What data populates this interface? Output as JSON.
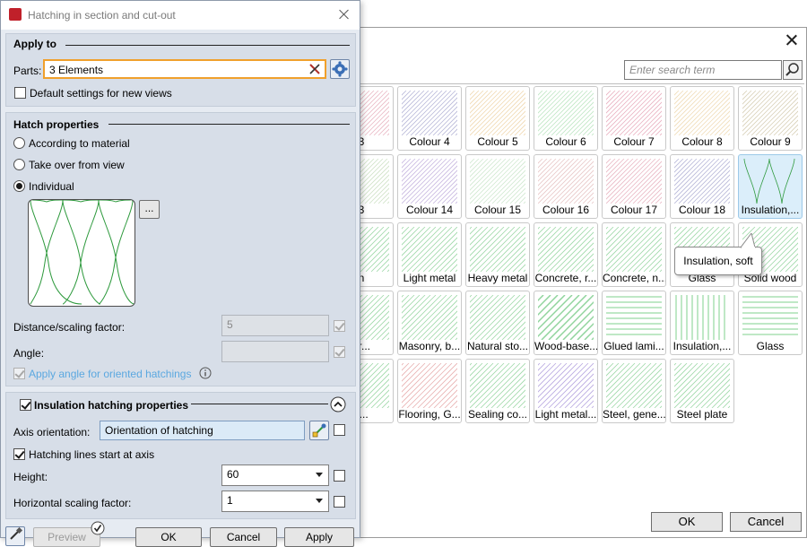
{
  "picker": {
    "search_placeholder": "Enter search term",
    "ok_label": "OK",
    "cancel_label": "Cancel",
    "tooltip": "Insulation, soft",
    "rows": [
      [
        "3",
        "Colour 4",
        "Colour 5",
        "Colour 6",
        "Colour 7",
        "Colour 8",
        "Colour 9"
      ],
      [
        "3",
        "Colour 14",
        "Colour 15",
        "Colour 16",
        "Colour 17",
        "Colour 18",
        "Insulation,..."
      ],
      [
        "n",
        "Light metal",
        "Heavy metal",
        "Concrete, r...",
        "Concrete, n...",
        "Glass",
        "Solid wood"
      ],
      [
        "er...",
        "Masonry, b...",
        "Natural sto...",
        "Wood-base...",
        "Glued lami...",
        "Insulation,...",
        "Glass"
      ],
      [
        "li...",
        "Flooring, G...",
        "Sealing co...",
        "Light metal...",
        "Steel, gene...",
        "Steel plate",
        ""
      ]
    ],
    "selected_item": "Insulation,..."
  },
  "dialog": {
    "title": "Hatching in section and cut-out",
    "apply_to": {
      "header": "Apply to",
      "parts_label": "Parts:",
      "parts_value": "3 Elements",
      "default_settings_label": "Default settings for new views",
      "default_settings_checked": false
    },
    "hatch_properties": {
      "header": "Hatch properties",
      "options": [
        "According to material",
        "Take over from view",
        "Individual"
      ],
      "selected": "Individual",
      "more_button": "...",
      "distance_label": "Distance/scaling factor:",
      "distance_value": "5",
      "angle_label": "Angle:",
      "angle_value": "",
      "apply_angle_label": "Apply angle for oriented hatchings",
      "apply_angle_checked": true
    },
    "insulation": {
      "header": "Insulation hatching properties",
      "enabled": true,
      "axis_label": "Axis orientation:",
      "axis_value": "Orientation of hatching",
      "start_at_axis_label": "Hatching lines start at axis",
      "start_at_axis_checked": true,
      "height_label": "Height:",
      "height_value": "60",
      "hscale_label": "Horizontal scaling factor:",
      "hscale_value": "1"
    },
    "footer": {
      "preview_label": "Preview",
      "ok_label": "OK",
      "cancel_label": "Cancel",
      "apply_label": "Apply"
    },
    "colors": {
      "focus_border": "#f0a02c",
      "link_text": "#5ba8e0",
      "insulation_hatch": "#2f9a3e",
      "selected_tile": "#dbeefa"
    }
  }
}
